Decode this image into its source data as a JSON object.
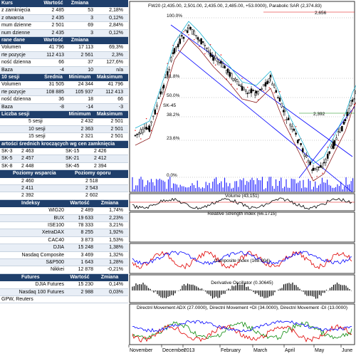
{
  "left_panel": {
    "section1": {
      "headers": [
        "Kurs",
        "Wartość",
        "Zmiana"
      ],
      "rows": [
        {
          "label": "z zamknięcia",
          "v1": "2 485",
          "v2": "53",
          "v3": "2,18%"
        },
        {
          "label": "z otwarcia",
          "v1": "2 435",
          "v2": "3",
          "v3": "0,12%"
        },
        {
          "label": "mum dzienne",
          "v1": "2 501",
          "v2": "69",
          "v3": "2,84%"
        },
        {
          "label": "num dzienne",
          "v1": "2 435",
          "v2": "3",
          "v3": "0,12%"
        }
      ]
    },
    "section2": {
      "headers": [
        "rane dane",
        "Wartość",
        "Zmiana"
      ],
      "rows": [
        {
          "label": "Volumen",
          "v1": "41 796",
          "v2": "17 113",
          "v3": "69,3%"
        },
        {
          "label": "rte pozycje",
          "v1": "112 413",
          "v2": "2 561",
          "v3": "2,3%"
        },
        {
          "label": "ność dzienna",
          "v1": "66",
          "v2": "37",
          "v3": "127,6%"
        },
        {
          "label": "Baza",
          "v1": "-4",
          "v2": "10",
          "v3": "n/a"
        }
      ]
    },
    "section3": {
      "headers": [
        "10 sesji",
        "Średnia",
        "Minimum",
        "Maksimum"
      ],
      "rows": [
        {
          "label": "Volumen",
          "v1": "31 505",
          "v2": "24 344",
          "v3": "41 796"
        },
        {
          "label": "rte pozycje",
          "v1": "108 885",
          "v2": "105 937",
          "v3": "112 413"
        },
        {
          "label": "ność dzienna",
          "v1": "36",
          "v2": "18",
          "v3": "66"
        },
        {
          "label": "Baza",
          "v1": "-8",
          "v2": "-14",
          "v3": "-3"
        }
      ]
    },
    "section4": {
      "headers": [
        "Liczba sesji",
        "Minimum",
        "Maksimum"
      ],
      "rows": [
        {
          "label": "5 sesji",
          "v1": "2 432",
          "v2": "2 501"
        },
        {
          "label": "10 sesji",
          "v1": "2 363",
          "v2": "2 501"
        },
        {
          "label": "15 sesji",
          "v1": "2 321",
          "v2": "2 501"
        }
      ]
    },
    "section5": {
      "header": "artości średnich kroczących wg cen zamknięcia",
      "rows": [
        {
          "a_label": "SK-3",
          "a_val": "2 463",
          "b_label": "SK-15",
          "b_val": "2 426"
        },
        {
          "a_label": "SK-5",
          "a_val": "2 457",
          "b_label": "SK-21",
          "b_val": "2 412"
        },
        {
          "a_label": "SK-8",
          "a_val": "2 448",
          "b_label": "SK-45",
          "b_val": "2 394"
        }
      ]
    },
    "section6": {
      "headers": [
        "Poziomy wsparcia",
        "Poziomy oporu"
      ],
      "rows": [
        {
          "support": "2 460",
          "resistance": "2 518"
        },
        {
          "support": "2 411",
          "resistance": "2 543"
        },
        {
          "support": "2 392",
          "resistance": "2 602"
        }
      ]
    },
    "section7": {
      "headers": [
        "Indeksy",
        "Wartość",
        "Zmiana"
      ],
      "rows": [
        {
          "label": "WIG20",
          "v1": "2 489",
          "v2": "1,74%"
        },
        {
          "label": "BUX",
          "v1": "19 633",
          "v2": "2,23%"
        },
        {
          "label": "ISE100",
          "v1": "78 333",
          "v2": "3,21%"
        },
        {
          "label": "XetraDAX",
          "v1": "8 255",
          "v2": "1,92%"
        },
        {
          "label": "CAC40",
          "v1": "3 873",
          "v2": "1,53%"
        },
        {
          "label": "DJIA",
          "v1": "15 248",
          "v2": "1,38%"
        },
        {
          "label": "Nasdaq Composite",
          "v1": "3 469",
          "v2": "1,32%"
        },
        {
          "label": "S&P500",
          "v1": "1 643",
          "v2": "1,28%"
        },
        {
          "label": "Nikkei",
          "v1": "12 878",
          "v2": "-0,21%"
        }
      ]
    },
    "section8": {
      "headers": [
        "Futures",
        "Wartość",
        "Zmiana"
      ],
      "rows": [
        {
          "label": "DJIA Futures",
          "v1": "15 230",
          "v2": "0,14%"
        },
        {
          "label": "Nasdaq 100 Futures",
          "v1": "2 988",
          "v2": "0,03%"
        }
      ]
    },
    "footer": "GPW, Reuters"
  },
  "chart": {
    "title": "FW20 (2,435.00, 2,501.00, 2,435.00, 2,485.00, +53.0000), Parabolic SAR (2,374.83)",
    "fib_levels": [
      "100.0%",
      "61.8%",
      "50.0%",
      "38.2%",
      "23.6%",
      "0.0%"
    ],
    "price_labels": [
      {
        "text": "2,656",
        "color": "#e00000"
      },
      {
        "text": "2,392",
        "color": "#0a8a0a"
      }
    ],
    "annotations": [
      "SK-45"
    ],
    "panels": [
      "Volume (43,151)",
      "Relative Strength Index (66.1715)",
      "Composite Index (168.904)",
      "Derivative Oscillator (0.30645)",
      "Directnl Movement ADX (27.0000), Directnl Movement +DI (34.0000), Directnl Movement -DI (13.0000)"
    ],
    "x_labels": [
      "November",
      "December",
      "2013",
      "February",
      "March",
      "April",
      "May",
      "June"
    ],
    "colors": {
      "up": "#ffffff",
      "down": "#000000",
      "sar": "#e00000",
      "sk45": "#8b1a1a",
      "bb": "#00aacc",
      "channel": "#0000ff"
    }
  }
}
